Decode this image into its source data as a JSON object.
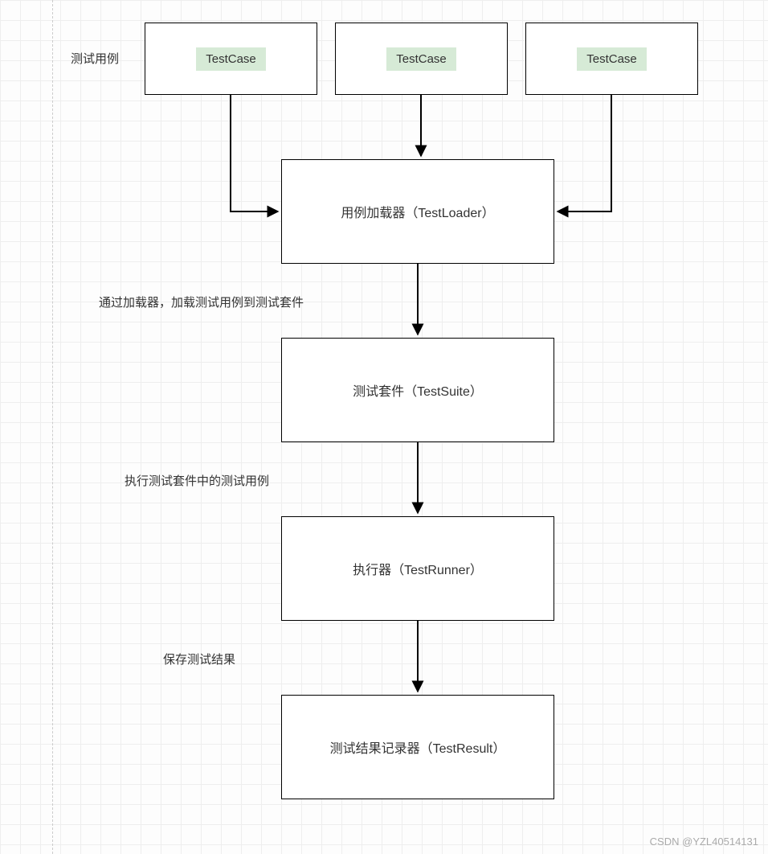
{
  "labels": {
    "row_label": "测试用例",
    "tc1": "TestCase",
    "tc2": "TestCase",
    "tc3": "TestCase",
    "loader": "用例加载器（TestLoader）",
    "suite": "测试套件（TestSuite）",
    "runner": "执行器（TestRunner）",
    "result": "测试结果记录器（TestResult）",
    "edge_loader_to_suite": "通过加载器，加载测试用例到测试套件",
    "edge_suite_to_runner": "执行测试套件中的测试用例",
    "edge_runner_to_result": "保存测试结果",
    "watermark": "CSDN @YZL40514131"
  },
  "diagram": {
    "nodes": [
      {
        "id": "tc1",
        "type": "TestCase"
      },
      {
        "id": "tc2",
        "type": "TestCase"
      },
      {
        "id": "tc3",
        "type": "TestCase"
      },
      {
        "id": "loader",
        "type": "TestLoader",
        "label_zh": "用例加载器"
      },
      {
        "id": "suite",
        "type": "TestSuite",
        "label_zh": "测试套件"
      },
      {
        "id": "runner",
        "type": "TestRunner",
        "label_zh": "执行器"
      },
      {
        "id": "result",
        "type": "TestResult",
        "label_zh": "测试结果记录器"
      }
    ],
    "edges": [
      {
        "from": "tc1",
        "to": "loader"
      },
      {
        "from": "tc2",
        "to": "loader"
      },
      {
        "from": "tc3",
        "to": "loader"
      },
      {
        "from": "loader",
        "to": "suite",
        "label": "通过加载器，加载测试用例到测试套件"
      },
      {
        "from": "suite",
        "to": "runner",
        "label": "执行测试套件中的测试用例"
      },
      {
        "from": "runner",
        "to": "result",
        "label": "保存测试结果"
      }
    ]
  }
}
